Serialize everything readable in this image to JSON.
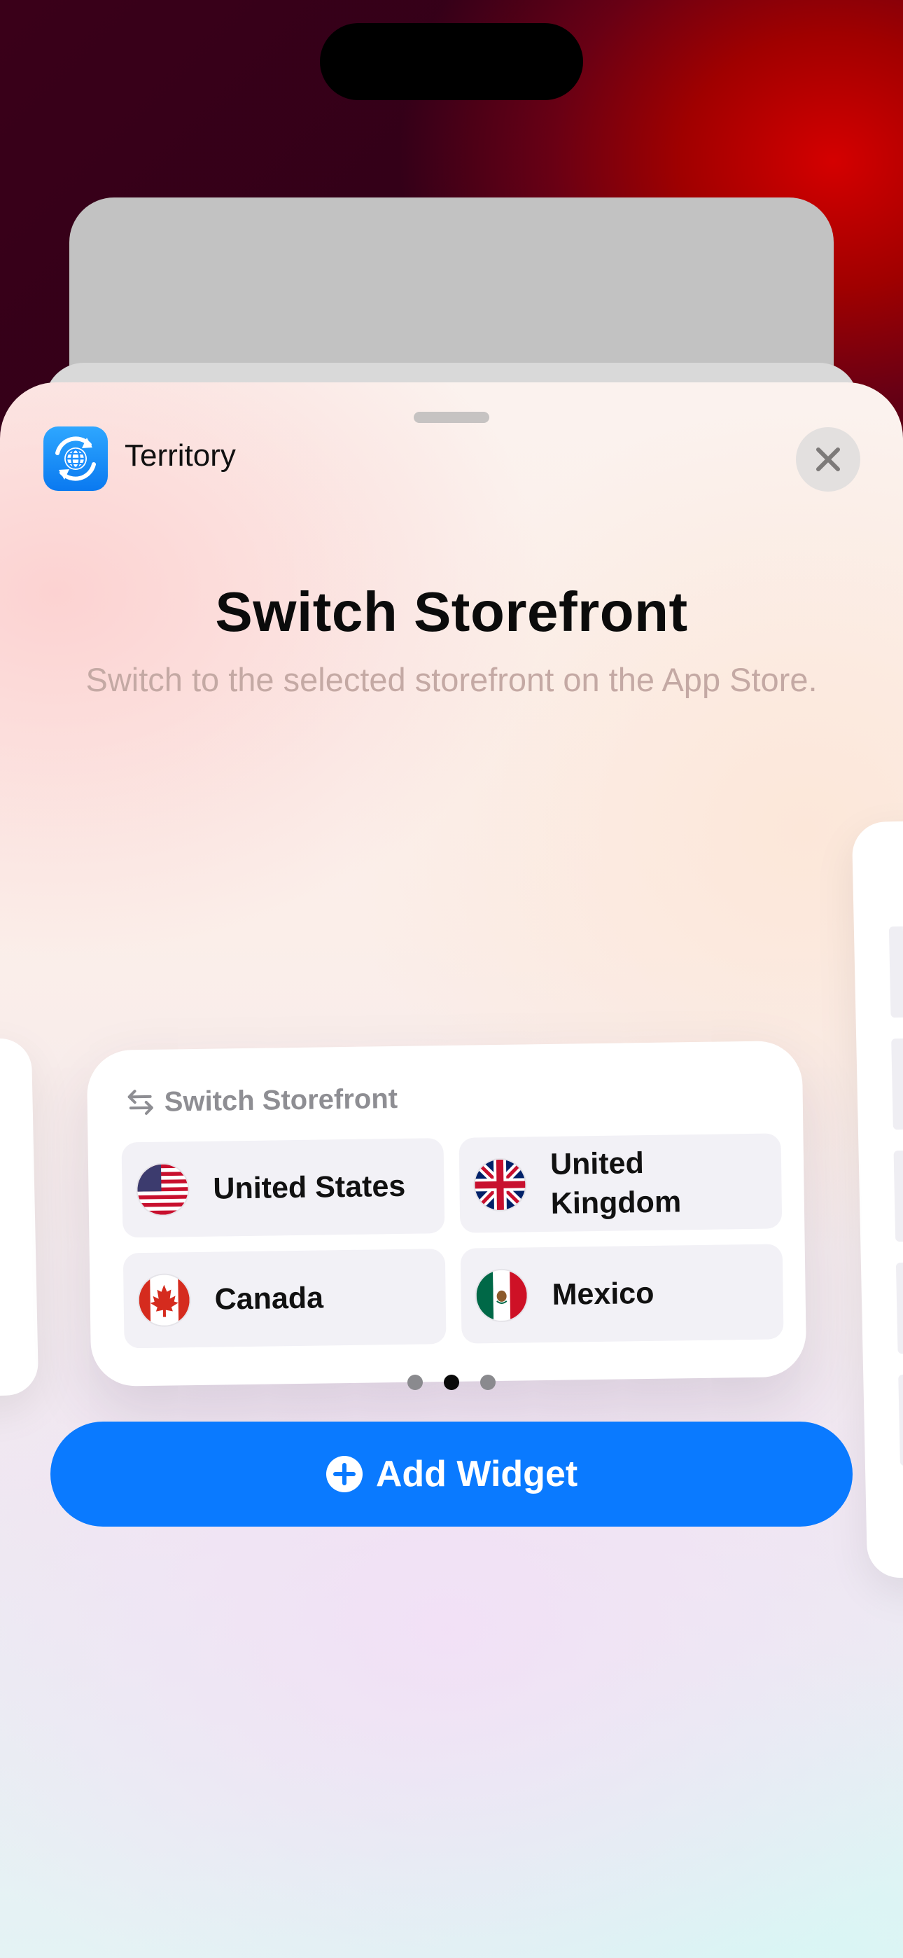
{
  "app": {
    "name": "Territory",
    "icon": "globe-sync-icon"
  },
  "sheet": {
    "title": "Switch Storefront",
    "subtitle": "Switch to the selected storefront on the App Store.",
    "close_icon": "close-icon"
  },
  "widget": {
    "header_icon": "arrows-swap-icon",
    "header_label": "Switch Storefront",
    "items": [
      {
        "label": "United States",
        "flag": "us-flag-icon"
      },
      {
        "label": "United Kingdom",
        "flag": "uk-flag-icon"
      },
      {
        "label": "Canada",
        "flag": "canada-flag-icon"
      },
      {
        "label": "Mexico",
        "flag": "mexico-flag-icon"
      }
    ]
  },
  "pager": {
    "count": 3,
    "active_index": 1
  },
  "add_button": {
    "label": "Add Widget",
    "icon": "plus-circle-icon"
  },
  "colors": {
    "accent": "#0a7aff",
    "tile_bg": "#f2f1f6",
    "subtitle": "#c4a9a4"
  }
}
